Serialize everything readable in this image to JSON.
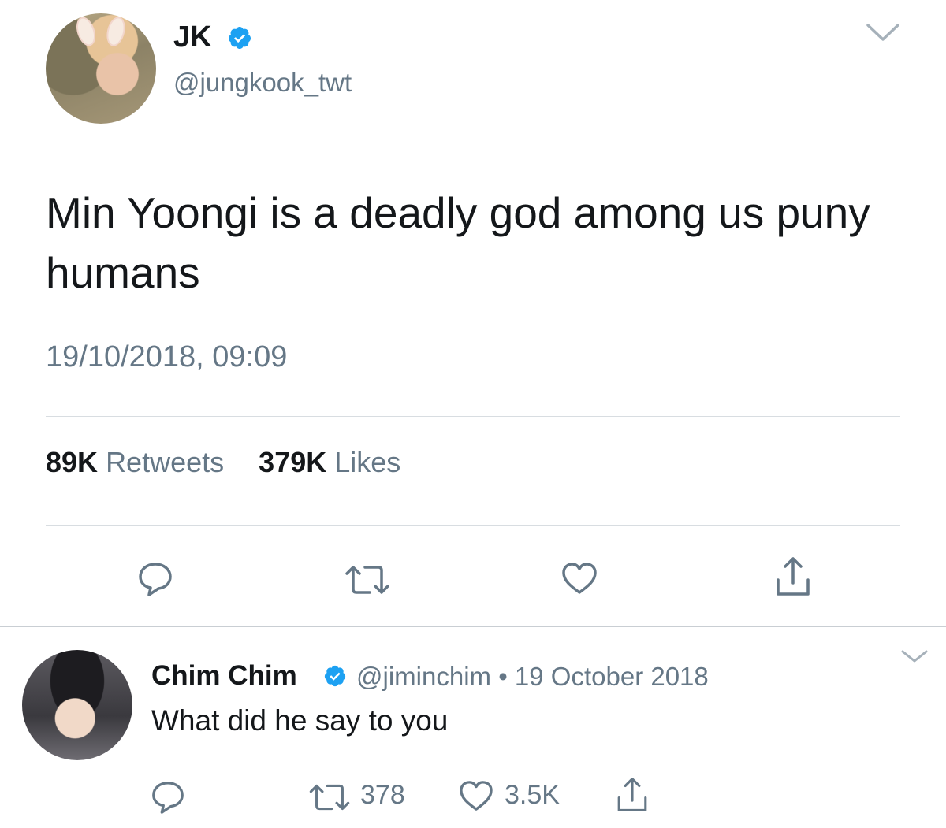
{
  "main_tweet": {
    "author_name": "JK",
    "author_handle": "@jungkook_twt",
    "verified": true,
    "text": "Min Yoongi is a deadly god among us puny humans",
    "timestamp": "19/10/2018, 09:09",
    "stats": {
      "retweets_count": "89K",
      "retweets_label": "Retweets",
      "likes_count": "379K",
      "likes_label": "Likes"
    },
    "actions": [
      "reply-icon",
      "retweet-icon",
      "like-icon",
      "share-icon"
    ]
  },
  "reply_tweet": {
    "author_name": "Chim Chim",
    "author_handle": "@jiminchim",
    "separator": "•",
    "date": "19 October 2018",
    "verified": true,
    "text": "What did he say to you",
    "retweet_count": "378",
    "like_count": "3.5K",
    "actions": [
      "reply-icon",
      "retweet-icon",
      "like-icon",
      "share-icon"
    ]
  },
  "colors": {
    "text_primary": "#14171a",
    "text_secondary": "#657786",
    "verified_blue": "#1da1f2",
    "divider": "#d8dde1"
  }
}
